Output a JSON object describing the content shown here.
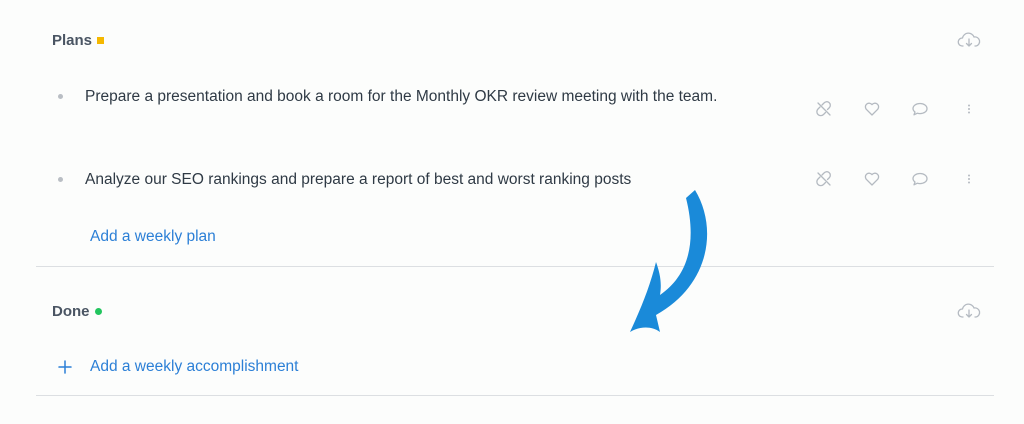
{
  "plans": {
    "title": "Plans",
    "status_color": "#f5b800",
    "download_icon": "cloud-download-icon",
    "items": [
      {
        "text": "Prepare a presentation and book a room for the Monthly OKR review meeting with the team."
      },
      {
        "text": "Analyze our SEO rankings and prepare a report of best and worst ranking posts"
      }
    ],
    "item_actions": [
      "unlink-icon",
      "heart-icon",
      "comment-icon",
      "more-vertical-icon"
    ],
    "add_label": "Add a weekly plan"
  },
  "done": {
    "title": "Done",
    "status_color": "#22c55e",
    "download_icon": "cloud-download-icon",
    "add_icon": "plus-icon",
    "add_label": "Add a weekly accomplishment"
  },
  "annotation": {
    "arrow_icon": "curved-arrow-icon",
    "arrow_color": "#1a8ad9"
  },
  "colors": {
    "accent": "#2b7fd6",
    "icon_gray": "#b4bac1"
  }
}
